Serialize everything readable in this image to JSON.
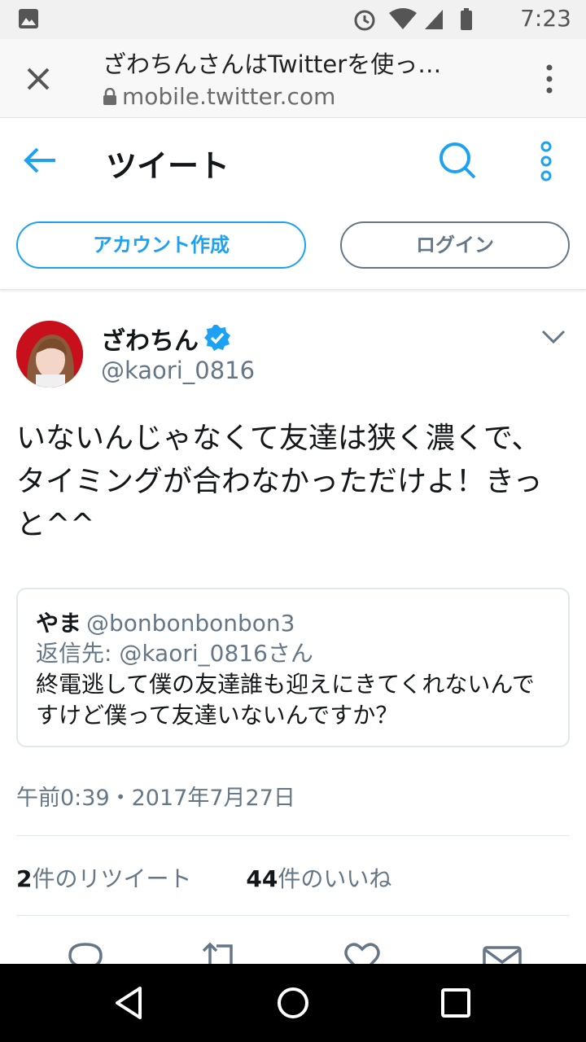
{
  "status_bar": {
    "time": "7:23"
  },
  "chrome": {
    "title": "ざわちんさんはTwitterを使っ…",
    "url": "mobile.twitter.com"
  },
  "header": {
    "title": "ツイート",
    "signup_label": "アカウント作成",
    "login_label": "ログイン"
  },
  "tweet": {
    "author_name": "ざわちん",
    "author_handle": "@kaori_0816",
    "text": "いないんじゃなくて友達は狭く濃くで、タイミングが合わなかっただけよ！きっと^^",
    "quote": {
      "name": "やま",
      "handle": "@bonbonbonbon3",
      "reply_to": "返信先: @kaori_0816さん",
      "text": "終電逃して僕の友達誰も迎えにきてくれないんですけど僕って友達いないんですか？"
    },
    "timestamp": "午前0:39・2017年7月27日",
    "retweets_count": "2",
    "retweets_label": "件のリツイート",
    "likes_count": "44",
    "likes_label_prefix": "件の",
    "likes_label": "いいね"
  },
  "colors": {
    "accent": "#1da1f2",
    "secondary_text": "#657786",
    "verified": "#1da1f2"
  }
}
